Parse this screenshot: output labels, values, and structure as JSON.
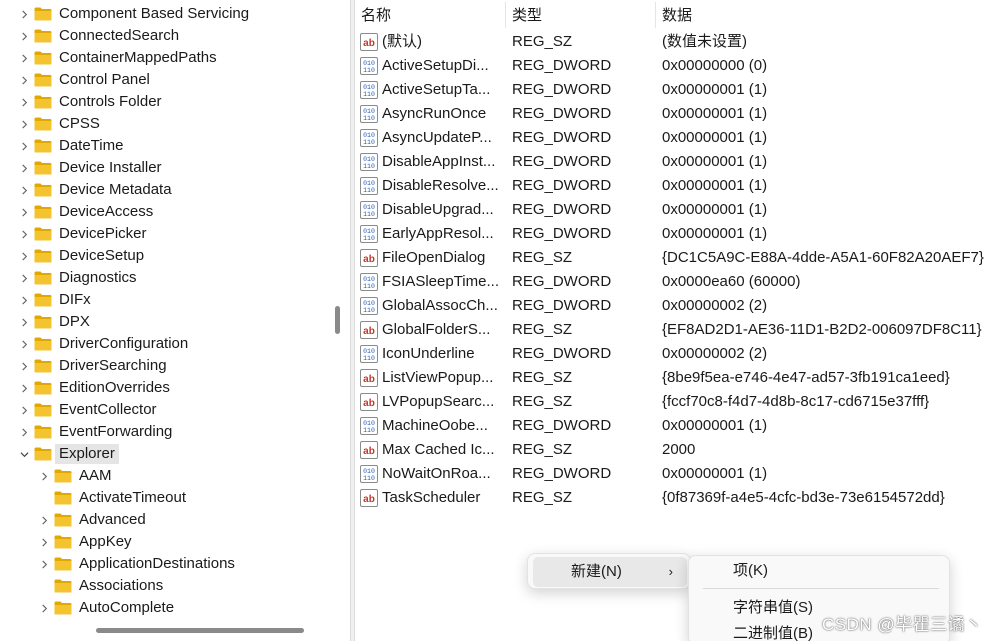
{
  "tree": {
    "items": [
      {
        "label": "Component Based Servicing",
        "level": 0,
        "expanded": false
      },
      {
        "label": "ConnectedSearch",
        "level": 0,
        "expanded": false
      },
      {
        "label": "ContainerMappedPaths",
        "level": 0,
        "expanded": false
      },
      {
        "label": "Control Panel",
        "level": 0,
        "expanded": false
      },
      {
        "label": "Controls Folder",
        "level": 0,
        "expanded": false
      },
      {
        "label": "CPSS",
        "level": 0,
        "expanded": false
      },
      {
        "label": "DateTime",
        "level": 0,
        "expanded": false
      },
      {
        "label": "Device Installer",
        "level": 0,
        "expanded": false
      },
      {
        "label": "Device Metadata",
        "level": 0,
        "expanded": false
      },
      {
        "label": "DeviceAccess",
        "level": 0,
        "expanded": false
      },
      {
        "label": "DevicePicker",
        "level": 0,
        "expanded": false
      },
      {
        "label": "DeviceSetup",
        "level": 0,
        "expanded": false
      },
      {
        "label": "Diagnostics",
        "level": 0,
        "expanded": false
      },
      {
        "label": "DIFx",
        "level": 0,
        "expanded": false
      },
      {
        "label": "DPX",
        "level": 0,
        "expanded": false
      },
      {
        "label": "DriverConfiguration",
        "level": 0,
        "expanded": false
      },
      {
        "label": "DriverSearching",
        "level": 0,
        "expanded": false
      },
      {
        "label": "EditionOverrides",
        "level": 0,
        "expanded": false
      },
      {
        "label": "EventCollector",
        "level": 0,
        "expanded": false
      },
      {
        "label": "EventForwarding",
        "level": 0,
        "expanded": false
      },
      {
        "label": "Explorer",
        "level": 0,
        "expanded": true,
        "selected": true
      },
      {
        "label": "AAM",
        "level": 1,
        "expanded": false
      },
      {
        "label": "ActivateTimeout",
        "level": 1,
        "expanded": false,
        "leaf": true
      },
      {
        "label": "Advanced",
        "level": 1,
        "expanded": false
      },
      {
        "label": "AppKey",
        "level": 1,
        "expanded": false
      },
      {
        "label": "ApplicationDestinations",
        "level": 1,
        "expanded": false
      },
      {
        "label": "Associations",
        "level": 1,
        "expanded": false,
        "leaf": true
      },
      {
        "label": "AutoComplete",
        "level": 1,
        "expanded": false
      }
    ]
  },
  "list": {
    "headers": {
      "name": "名称",
      "type": "类型",
      "data": "数据"
    },
    "rows": [
      {
        "name": "(默认)",
        "type": "REG_SZ",
        "data": "(数值未设置)",
        "kind": "sz"
      },
      {
        "name": "ActiveSetupDi...",
        "type": "REG_DWORD",
        "data": "0x00000000 (0)",
        "kind": "bin"
      },
      {
        "name": "ActiveSetupTa...",
        "type": "REG_DWORD",
        "data": "0x00000001 (1)",
        "kind": "bin"
      },
      {
        "name": "AsyncRunOnce",
        "type": "REG_DWORD",
        "data": "0x00000001 (1)",
        "kind": "bin"
      },
      {
        "name": "AsyncUpdateP...",
        "type": "REG_DWORD",
        "data": "0x00000001 (1)",
        "kind": "bin"
      },
      {
        "name": "DisableAppInst...",
        "type": "REG_DWORD",
        "data": "0x00000001 (1)",
        "kind": "bin"
      },
      {
        "name": "DisableResolve...",
        "type": "REG_DWORD",
        "data": "0x00000001 (1)",
        "kind": "bin"
      },
      {
        "name": "DisableUpgrad...",
        "type": "REG_DWORD",
        "data": "0x00000001 (1)",
        "kind": "bin"
      },
      {
        "name": "EarlyAppResol...",
        "type": "REG_DWORD",
        "data": "0x00000001 (1)",
        "kind": "bin"
      },
      {
        "name": "FileOpenDialog",
        "type": "REG_SZ",
        "data": "{DC1C5A9C-E88A-4dde-A5A1-60F82A20AEF7}",
        "kind": "sz"
      },
      {
        "name": "FSIASleepTime...",
        "type": "REG_DWORD",
        "data": "0x0000ea60 (60000)",
        "kind": "bin"
      },
      {
        "name": "GlobalAssocCh...",
        "type": "REG_DWORD",
        "data": "0x00000002 (2)",
        "kind": "bin"
      },
      {
        "name": "GlobalFolderS...",
        "type": "REG_SZ",
        "data": "{EF8AD2D1-AE36-11D1-B2D2-006097DF8C11}",
        "kind": "sz"
      },
      {
        "name": "IconUnderline",
        "type": "REG_DWORD",
        "data": "0x00000002 (2)",
        "kind": "bin"
      },
      {
        "name": "ListViewPopup...",
        "type": "REG_SZ",
        "data": "{8be9f5ea-e746-4e47-ad57-3fb191ca1eed}",
        "kind": "sz"
      },
      {
        "name": "LVPopupSearc...",
        "type": "REG_SZ",
        "data": "{fccf70c8-f4d7-4d8b-8c17-cd6715e37fff}",
        "kind": "sz"
      },
      {
        "name": "MachineOobe...",
        "type": "REG_DWORD",
        "data": "0x00000001 (1)",
        "kind": "bin"
      },
      {
        "name": "Max Cached Ic...",
        "type": "REG_SZ",
        "data": "2000",
        "kind": "sz"
      },
      {
        "name": "NoWaitOnRoa...",
        "type": "REG_DWORD",
        "data": "0x00000001 (1)",
        "kind": "bin"
      },
      {
        "name": "TaskScheduler",
        "type": "REG_SZ",
        "data": "{0f87369f-a4e5-4cfc-bd3e-73e6154572dd}",
        "kind": "sz"
      }
    ]
  },
  "context_menu": {
    "new_label": "新建(N)",
    "new_arrow": "›",
    "submenu": {
      "key": "项(K)",
      "string_value": "字符串值(S)",
      "binary_value": "二进制值(B)"
    }
  },
  "watermark": "CSDN @毕瞿三谲丶",
  "colors": {
    "folder": "#f4c430",
    "folder_dark": "#e0a800",
    "selected_bg": "#e5e5e5",
    "menu_highlight": "#e8e8e8",
    "icon_sz": "#c0392b",
    "icon_bin": "#1f5fbf"
  }
}
